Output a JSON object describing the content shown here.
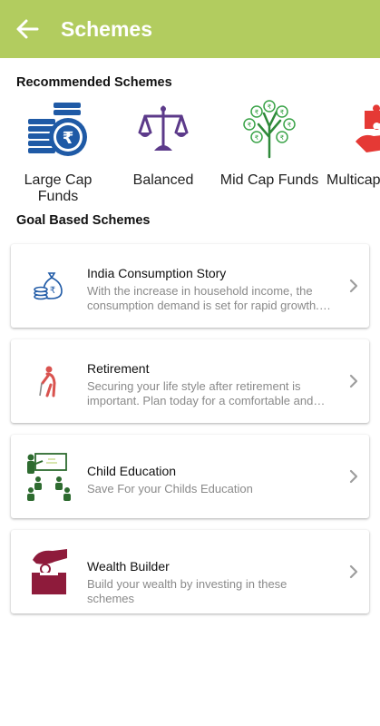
{
  "appbar": {
    "title": "Schemes",
    "back_icon": "arrow-left-icon",
    "color": "#b2cc5f"
  },
  "recommended": {
    "title": "Recommended Schemes",
    "items": [
      {
        "label": "Large Cap Funds",
        "icon": "coin-stack-rupee-icon"
      },
      {
        "label": "Balanced",
        "icon": "balance-scale-icon"
      },
      {
        "label": "Mid Cap Funds",
        "icon": "money-tree-icon"
      },
      {
        "label": "Multicap",
        "icon": "puzzle-hand-icon"
      }
    ]
  },
  "goals": {
    "title": "Goal Based Schemes",
    "items": [
      {
        "title": "India Consumption Story",
        "desc": "With the increase in household income, the consumption demand is set for rapid growth. Inv...",
        "icon": "money-bag-coins-icon"
      },
      {
        "title": "Retirement",
        "desc": "Securing your life style after retirement is important. Plan today for a comfortable and ind...",
        "icon": "elderly-person-icon"
      },
      {
        "title": "Child Education",
        "desc": "Save For your Childs Education",
        "icon": "classroom-icon"
      },
      {
        "title": "Wealth Builder",
        "desc": "Build your wealth by investing in these schemes",
        "icon": "hand-coin-box-icon"
      }
    ]
  }
}
